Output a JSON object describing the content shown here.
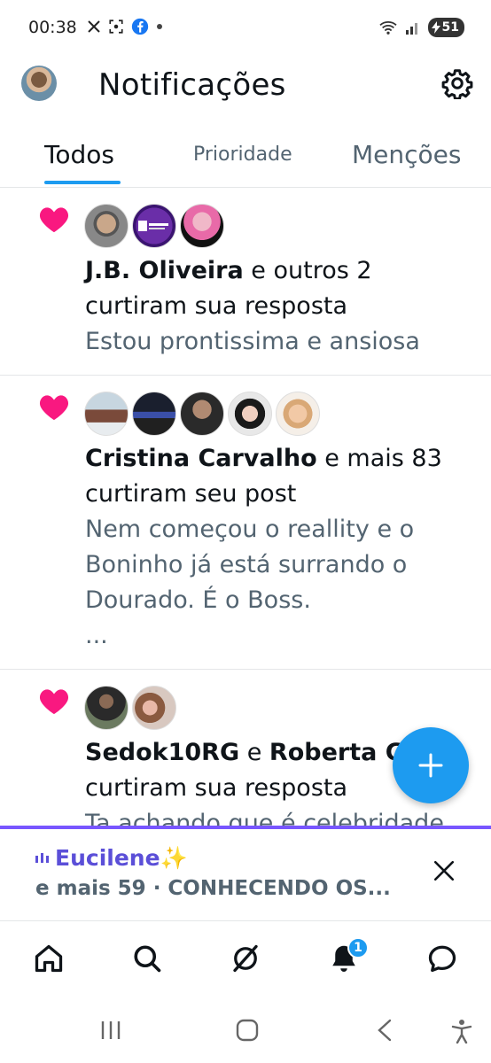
{
  "status_bar": {
    "time": "00:38",
    "battery": "51"
  },
  "header": {
    "title": "Notificações"
  },
  "tabs": [
    {
      "label": "Todos"
    },
    {
      "label": "Prioridade"
    },
    {
      "label": "Menções"
    }
  ],
  "notifications": [
    {
      "actor": "J.B. Oliveira",
      "others": " e outros 2",
      "action": "curtiram sua resposta",
      "snippet": "Estou prontissima e ansiosa"
    },
    {
      "actor": "Cristina Carvalho",
      "others": " e mais 83",
      "action": "curtiram seu post",
      "snippet_lines": [
        "Nem começou o reallity e o",
        "Boninho já está surrando o",
        "Dourado. É o Boss.",
        "..."
      ]
    },
    {
      "actor": "Sedok10RG",
      "joiner": " e ",
      "actor2": "Roberta Ga",
      "action": "curtiram sua resposta",
      "snippet": "Ta achando que é celebridade"
    }
  ],
  "live_banner": {
    "host": "Eucilene✨",
    "subtitle": "e mais 59 · CONHECENDO OS..."
  },
  "bottom_nav": {
    "items": [
      "home-icon",
      "search-icon",
      "grok-icon",
      "notifications-icon",
      "messages-icon"
    ],
    "notifications_badge": "1"
  },
  "colors": {
    "accent": "#1d9bf0",
    "like": "#f91880",
    "live": "#7856ff"
  }
}
